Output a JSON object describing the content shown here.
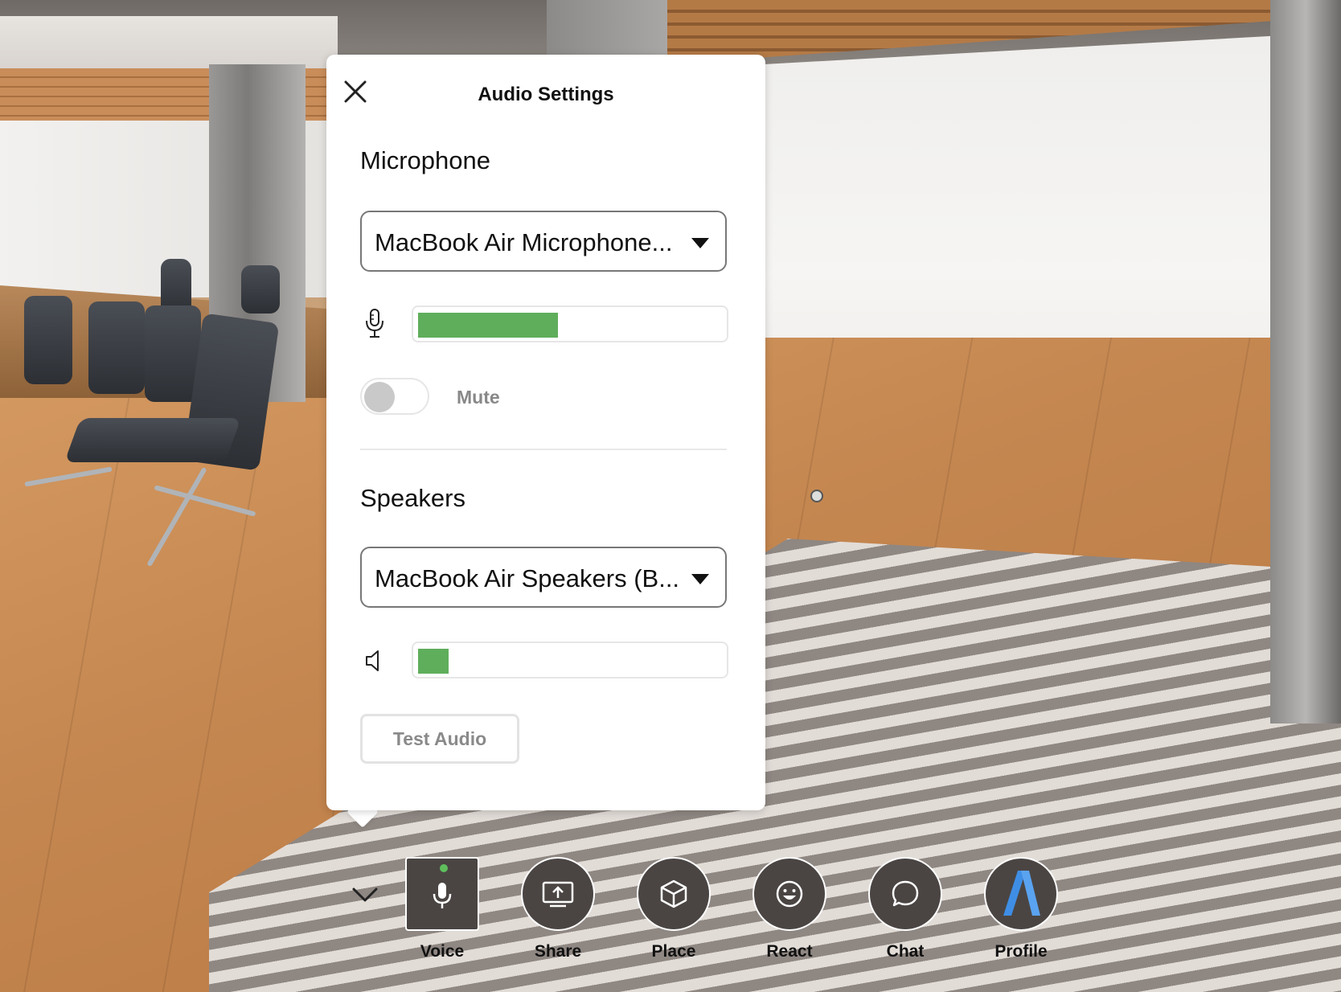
{
  "panel": {
    "title": "Audio Settings",
    "close_icon": "close-icon"
  },
  "microphone": {
    "section_title": "Microphone",
    "device": "MacBook Air Microphone...",
    "level_percent": 46,
    "level_color": "#5fae5c",
    "mute_label": "Mute",
    "mute_on": false
  },
  "speakers": {
    "section_title": "Speakers",
    "device": "MacBook Air Speakers (B...",
    "level_percent": 10,
    "level_color": "#5fae5c",
    "test_button": "Test Audio"
  },
  "toolbar": {
    "items": [
      {
        "label": "Voice",
        "icon": "microphone-icon",
        "active": true
      },
      {
        "label": "Share",
        "icon": "screen-share-icon"
      },
      {
        "label": "Place",
        "icon": "cube-icon"
      },
      {
        "label": "React",
        "icon": "smiley-icon"
      },
      {
        "label": "Chat",
        "icon": "chat-bubble-icon"
      },
      {
        "label": "Profile",
        "icon": "profile-avatar-icon"
      }
    ],
    "active_dot_color": "#5fbf5c"
  }
}
